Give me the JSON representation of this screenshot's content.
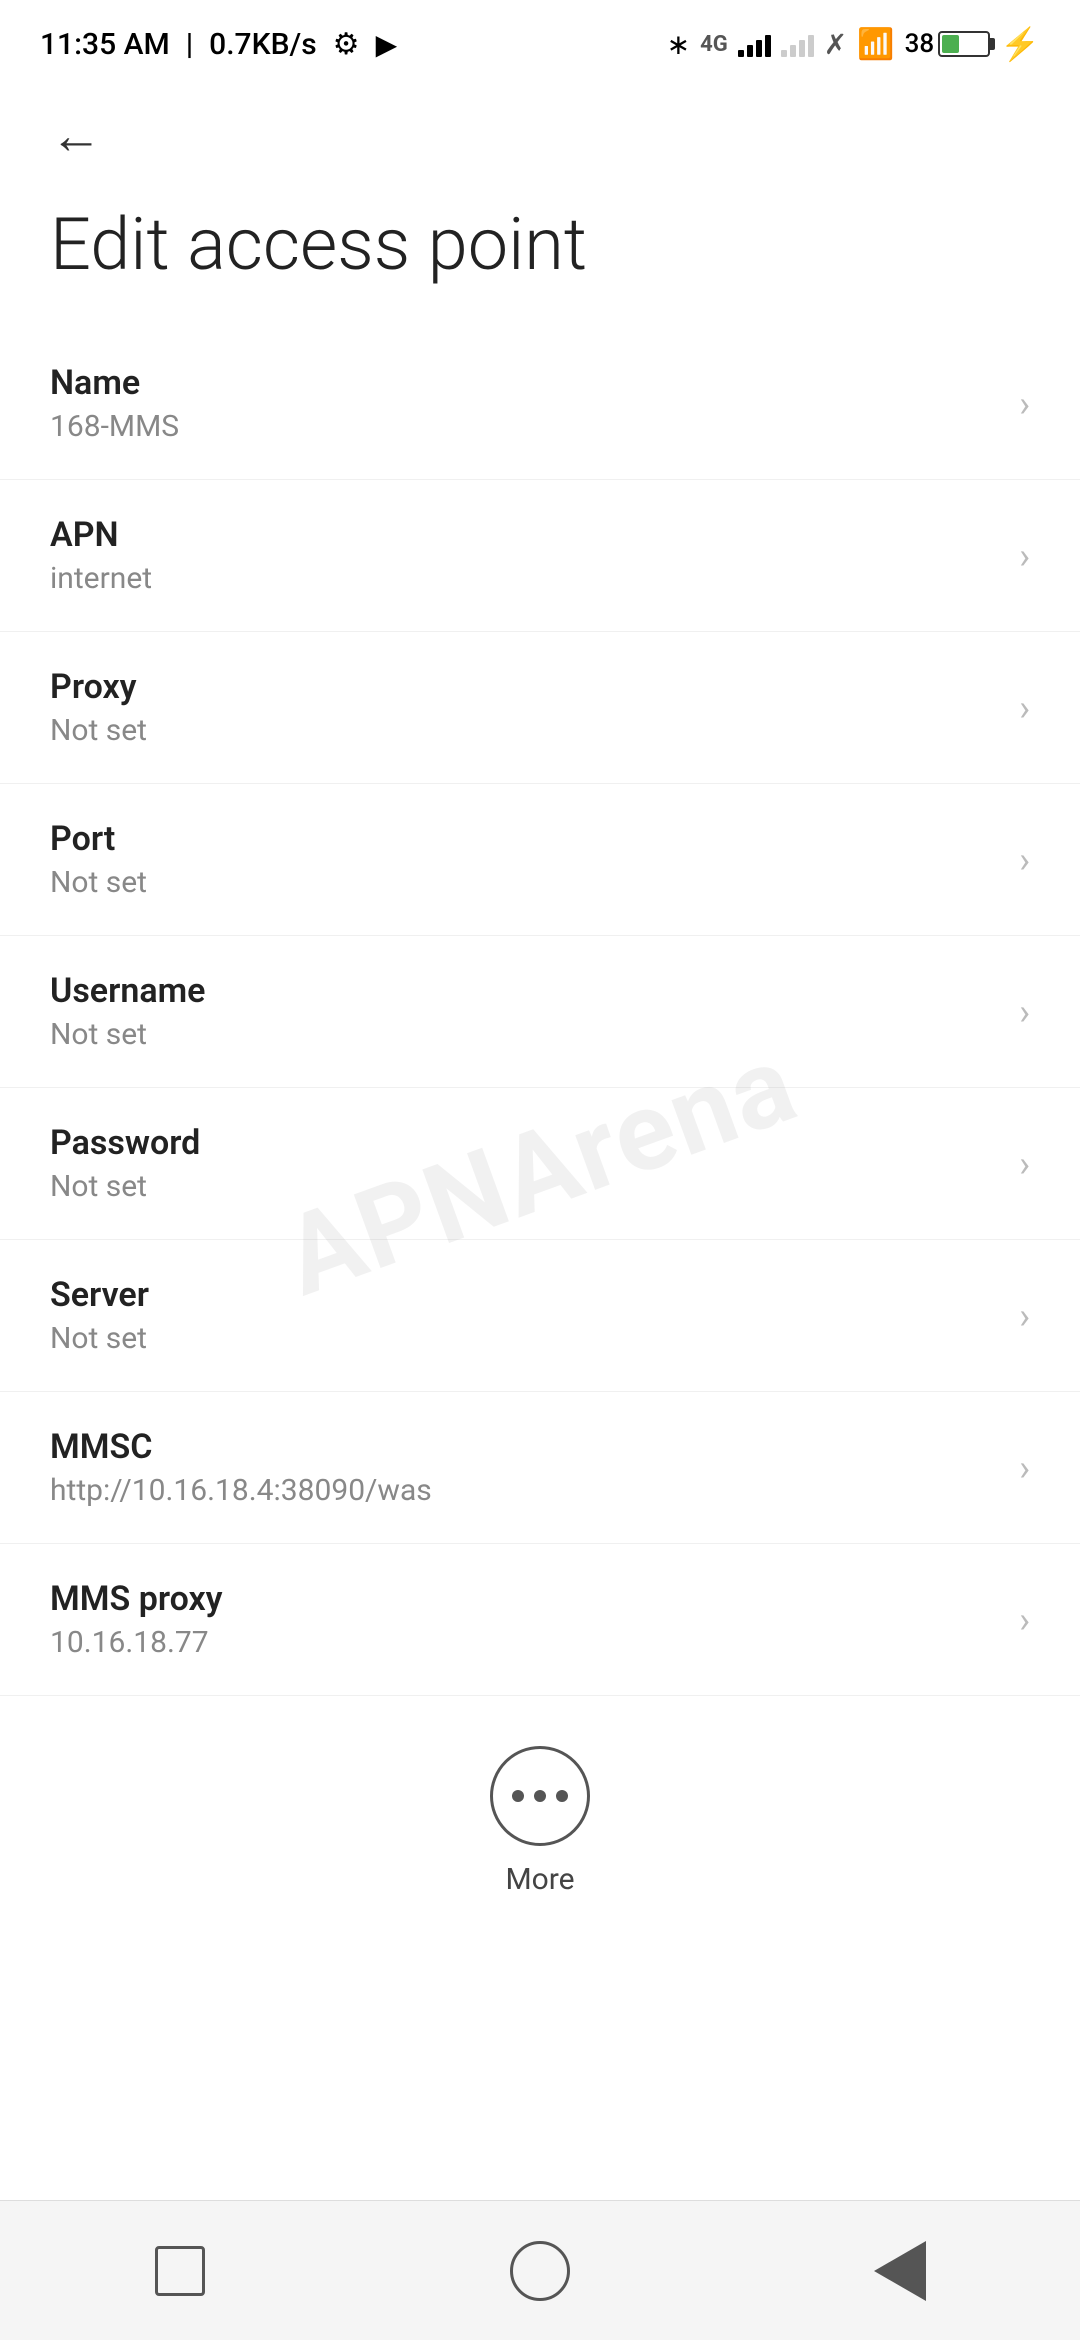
{
  "status_bar": {
    "time": "11:35 AM",
    "speed": "0.7KB/s"
  },
  "page": {
    "title": "Edit access point",
    "back_label": "←"
  },
  "settings_items": [
    {
      "label": "Name",
      "value": "168-MMS"
    },
    {
      "label": "APN",
      "value": "internet"
    },
    {
      "label": "Proxy",
      "value": "Not set"
    },
    {
      "label": "Port",
      "value": "Not set"
    },
    {
      "label": "Username",
      "value": "Not set"
    },
    {
      "label": "Password",
      "value": "Not set"
    },
    {
      "label": "Server",
      "value": "Not set"
    },
    {
      "label": "MMSC",
      "value": "http://10.16.18.4:38090/was"
    },
    {
      "label": "MMS proxy",
      "value": "10.16.18.77"
    }
  ],
  "more_button": {
    "label": "More"
  },
  "bottom_nav": {
    "square_label": "square",
    "circle_label": "home",
    "back_label": "back"
  },
  "watermark": {
    "text": "APNArena"
  }
}
